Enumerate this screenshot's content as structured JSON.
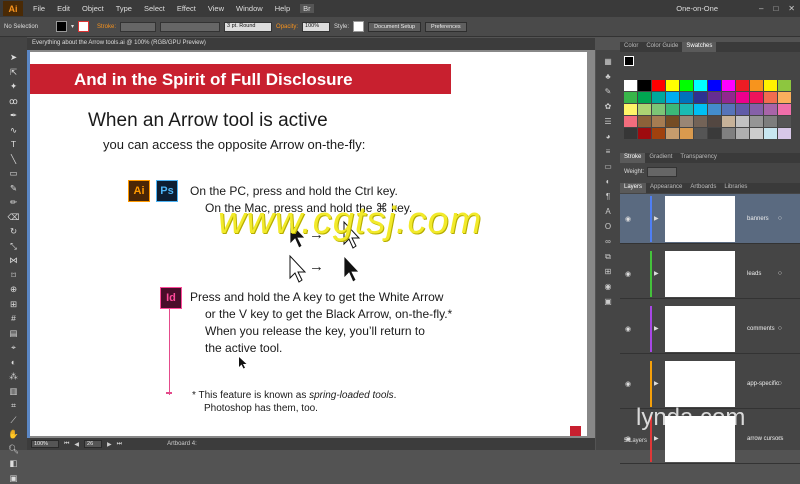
{
  "menubar": {
    "logo": "Ai",
    "items": [
      "File",
      "Edit",
      "Object",
      "Type",
      "Select",
      "Effect",
      "View",
      "Window",
      "Help"
    ],
    "br": "Br",
    "workspace": "One-on-One"
  },
  "control": {
    "selection": "No Selection",
    "stroke_label": "Stroke:",
    "brush": "3 pt. Round",
    "opacity_label": "Opacity:",
    "opacity": "100%",
    "style_label": "Style:",
    "doc_setup": "Document Setup",
    "preferences": "Preferences"
  },
  "document": {
    "tab_title": "Everything about the Arrow tools.ai @ 100% (RGB/GPU Preview)"
  },
  "slide": {
    "title": "And in the Spirit of Full Disclosure",
    "heading": "When an Arrow tool is active",
    "subheading": "you can access the opposite Arrow on-the-fly:",
    "badge_ai": "Ai",
    "badge_ps": "Ps",
    "badge_id": "Id",
    "pc_line": "On the PC, press and hold the Ctrl key.",
    "mac_line": "On the Mac, press and hold the ⌘ key.",
    "arrow_glyph": "→",
    "id_lines": [
      "Press and hold the A key to get the White Arrow",
      "or the V key to get the Black Arrow, on-the-fly.*",
      "When you release the key, you’ll return to",
      "the active tool."
    ],
    "note_prefix": "* This feature is known as ",
    "note_em": "spring-loaded tools",
    "note_suffix": ".",
    "note_line2": "Photoshop has them, too."
  },
  "watermark": "www.cgtsj.com",
  "statusbar": {
    "zoom": "100%",
    "artboard_num": "26",
    "artboard_label": "Artboard 4:"
  },
  "panels": {
    "swatch_tabs": [
      "Color",
      "Color Guide",
      "Swatches"
    ],
    "stroke_tabs": [
      "Stroke",
      "Gradient",
      "Transparency"
    ],
    "weight_label": "Weight:",
    "layer_tabs": [
      "Layers",
      "Appearance",
      "Artboards",
      "Libraries"
    ],
    "layers": [
      {
        "name": "banners",
        "color": "#4f7ff5"
      },
      {
        "name": "leads",
        "color": "#44c23b"
      },
      {
        "name": "comments",
        "color": "#a847e6"
      },
      {
        "name": "app-specific",
        "color": "#f5a00a"
      },
      {
        "name": "arrow cursors",
        "color": "#e03838"
      }
    ],
    "layers_count": "5 Layers",
    "swatch_colors": [
      "#ffffff",
      "#000000",
      "#ff0000",
      "#ffff00",
      "#00ff00",
      "#00ffff",
      "#0000ff",
      "#ff00ff",
      "#ed1c24",
      "#f7941d",
      "#fff200",
      "#8dc63f",
      "#39b54a",
      "#00a651",
      "#00a99d",
      "#00aeef",
      "#0072bc",
      "#2e3192",
      "#662d91",
      "#92278f",
      "#ec008c",
      "#ed145b",
      "#f26c4f",
      "#fbaf5d",
      "#fff568",
      "#acd373",
      "#7cc576",
      "#3cb878",
      "#1abbb4",
      "#00bff3",
      "#448ccb",
      "#5674b9",
      "#605ca8",
      "#8560a8",
      "#a864a8",
      "#f06eaa",
      "#f26d7d",
      "#8c6239",
      "#a67c52",
      "#754c24",
      "#998675",
      "#736357",
      "#534741",
      "#c7b299",
      "#c2c2c2",
      "#959595",
      "#7d7d7d",
      "#555555",
      "#363636",
      "#9e0b0f",
      "#a0410d",
      "#c69c6d",
      "#d99a4e",
      "#555555",
      "#3a3a3a",
      "#808080",
      "#b0b0b0",
      "#cccccc",
      "#c8e6f0",
      "#d8c8e8"
    ]
  },
  "lynda": "lynda.com"
}
